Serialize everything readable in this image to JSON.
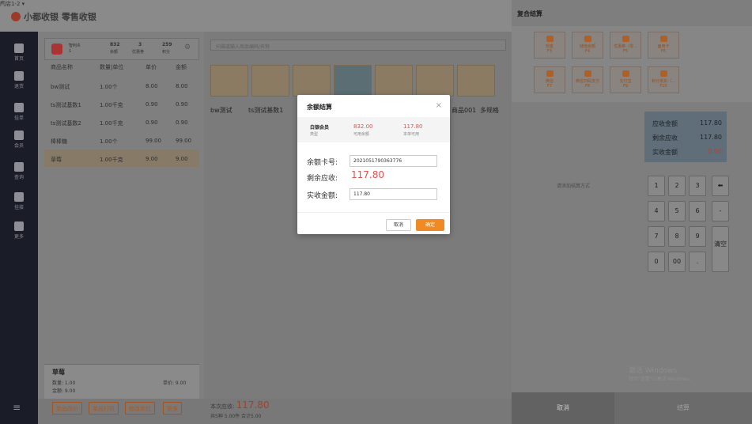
{
  "app": {
    "brand": "小都收银",
    "mode": "零售收银",
    "store": "门店1-2",
    "dropdown": "▾",
    "wifi": "≋"
  },
  "nav": [
    {
      "label": "首页",
      "icon": "home-icon"
    },
    {
      "label": "退货",
      "icon": "return-icon"
    },
    {
      "label": "挂单",
      "icon": "hold-icon"
    },
    {
      "label": "会员",
      "icon": "member-icon"
    },
    {
      "label": "查询",
      "icon": "search-icon"
    },
    {
      "label": "挂接",
      "icon": "cashbox-icon"
    },
    {
      "label": "更多",
      "icon": "grid-icon"
    }
  ],
  "member": {
    "name": "智利炎",
    "phone": "1                  ",
    "balance": "832",
    "balance_label": "余额",
    "coupons": "3",
    "coupons_label": "优惠券",
    "points": "259",
    "points_label": "积分"
  },
  "cart": {
    "headers": [
      "商品名称",
      "数量|单位",
      "单价",
      "金额"
    ],
    "rows": [
      {
        "name": "bw测试",
        "qty": "1.00个",
        "price": "8.00",
        "amount": "8.00"
      },
      {
        "name": "ts测试基数1",
        "qty": "1.00千克",
        "price": "0.90",
        "amount": "0.90"
      },
      {
        "name": "ts测试基数2",
        "qty": "1.00千克",
        "price": "0.90",
        "amount": "0.90"
      },
      {
        "name": "棒棒糖",
        "qty": "1.00个",
        "price": "99.00",
        "amount": "99.00"
      },
      {
        "name": "草莓",
        "qty": "1.00千克",
        "price": "9.00",
        "amount": "9.00"
      }
    ],
    "foot": {
      "name": "草莓",
      "qty": "数量: 1.00",
      "amount": "金额: 9.00",
      "price": "单价: 9.00"
    }
  },
  "bottom": {
    "buttons": [
      "单品改价",
      "单品打折",
      "修改单位",
      "更多"
    ],
    "due_label": "本次应收:",
    "due": "117.80",
    "summary": "共5种 5.00件 合计5.00"
  },
  "products": {
    "search_placeholder": "扫描或输入商品编码/名称",
    "names": [
      "bw测试",
      "ts测试基数1",
      "商品001",
      "多规格"
    ]
  },
  "right": {
    "title": "复合结算",
    "pay_methods": [
      {
        "label": "现金",
        "key": "F3",
        "icon": "yen-icon"
      },
      {
        "label": "储值余额",
        "key": "F4",
        "icon": "wallet-icon"
      },
      {
        "label": "优惠券（零...",
        "key": "F5",
        "icon": "coupon-icon"
      },
      {
        "label": "面用卡",
        "key": "F6",
        "icon": "card-icon"
      },
      {
        "label": "微信",
        "key": "F7",
        "icon": "wechat-icon"
      },
      {
        "label": "微信扫码支付",
        "key": "F8",
        "icon": "scan-icon"
      },
      {
        "label": "支付宝",
        "key": "F9",
        "icon": "alipay-icon"
      },
      {
        "label": "积分抵扣（...",
        "key": "F10",
        "icon": "points-icon"
      }
    ],
    "summary": [
      {
        "label": "应收金额",
        "value": "117.80"
      },
      {
        "label": "剩余应收",
        "value": "117.80"
      },
      {
        "label": "实收金额",
        "value": "0.00"
      }
    ],
    "hint": "请添加结算方式",
    "keys": [
      "1",
      "2",
      "3",
      "⬅",
      "4",
      "5",
      "6",
      "-",
      "7",
      "8",
      "9",
      "清空",
      "0",
      "00",
      "."
    ],
    "cancel": "取消",
    "settle": "结算",
    "watermark_title": "激活 Windows",
    "watermark_sub": "转到\"设置\"以激活 Windows。"
  },
  "modal": {
    "title": "余额结算",
    "close": "×",
    "member_name": "白银会员",
    "member_type": "类型",
    "balance": "832.00",
    "balance_label": "可用余额",
    "available": "117.80",
    "available_label": "本单可用",
    "card_label": "余额卡号:",
    "card_value": "2021051790363776",
    "due_label": "剩余应收:",
    "due_value": "117.80",
    "paid_label": "实收金额:",
    "paid_value": "117.80",
    "cancel": "取消",
    "ok": "确定"
  },
  "colors": {
    "accent": "#f08a24",
    "danger": "#e8504a",
    "sidebar": "#1a1c28"
  }
}
